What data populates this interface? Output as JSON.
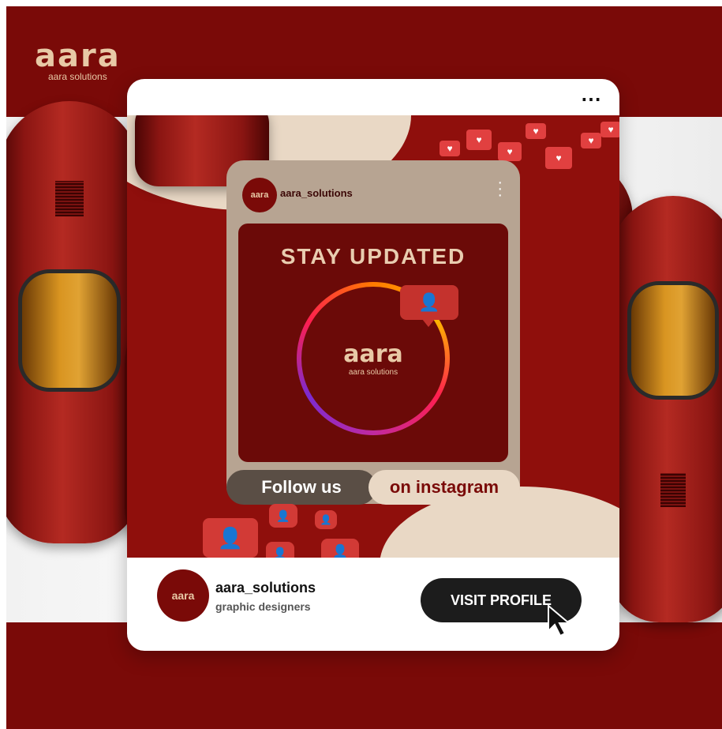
{
  "brand": {
    "logo_mark": "aara",
    "logo_sub": "aara solutions"
  },
  "card": {
    "more_icon": "⋯"
  },
  "post": {
    "avatar_text": "aara",
    "username": "aara_solutions",
    "headline": "STAY UPDATED",
    "ring_mark": "aara",
    "ring_sub": "aara solutions",
    "follow_label": "Follow us",
    "instagram_label": "on instagram"
  },
  "footer": {
    "avatar_text": "aara",
    "username": "aara_solutions",
    "subtitle": "graphic designers",
    "visit_label": "VISIT PROFILE"
  },
  "colors": {
    "brand_red": "#7a0a08",
    "cream": "#e8c9a6",
    "dark": "#1c1c1c"
  }
}
